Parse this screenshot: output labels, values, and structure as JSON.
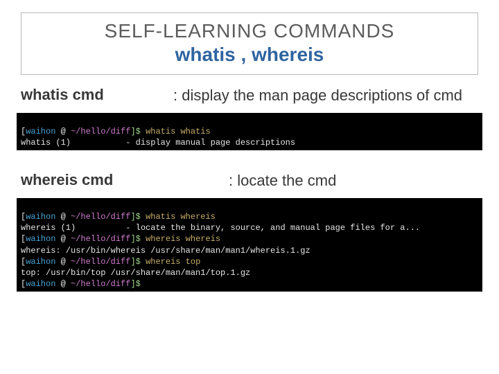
{
  "title": {
    "line1": "SELF-LEARNING COMMANDS",
    "line2": "whatis , whereis"
  },
  "row1": {
    "left": "whatis cmd",
    "right": ": display the man page descriptions of cmd"
  },
  "row2": {
    "left": "whereis cmd",
    "right": ": locate the cmd"
  },
  "term1": {
    "l1": {
      "user": "waihon",
      "at": " @ ",
      "path": "~/hello/diff",
      "prompt": "]$ ",
      "cmd": "whatis whatis"
    },
    "l2": "whatis (1)           - display manual page descriptions"
  },
  "term2": {
    "l1": {
      "user": "waihon",
      "at": " @ ",
      "path": "~/hello/diff",
      "prompt": "]$ ",
      "cmd": "whatis whereis"
    },
    "l2": "whereis (1)          - locate the binary, source, and manual page files for a...",
    "l3": {
      "user": "waihon",
      "at": " @ ",
      "path": "~/hello/diff",
      "prompt": "]$ ",
      "cmd": "whereis whereis"
    },
    "l4": "whereis: /usr/bin/whereis /usr/share/man/man1/whereis.1.gz",
    "l5": {
      "user": "waihon",
      "at": " @ ",
      "path": "~/hello/diff",
      "prompt": "]$ ",
      "cmd": "whereis top"
    },
    "l6": "top: /usr/bin/top /usr/share/man/man1/top.1.gz",
    "l7": {
      "user": "waihon",
      "at": " @ ",
      "path": "~/hello/diff",
      "prompt": "]$ ",
      "cmd": ""
    }
  }
}
